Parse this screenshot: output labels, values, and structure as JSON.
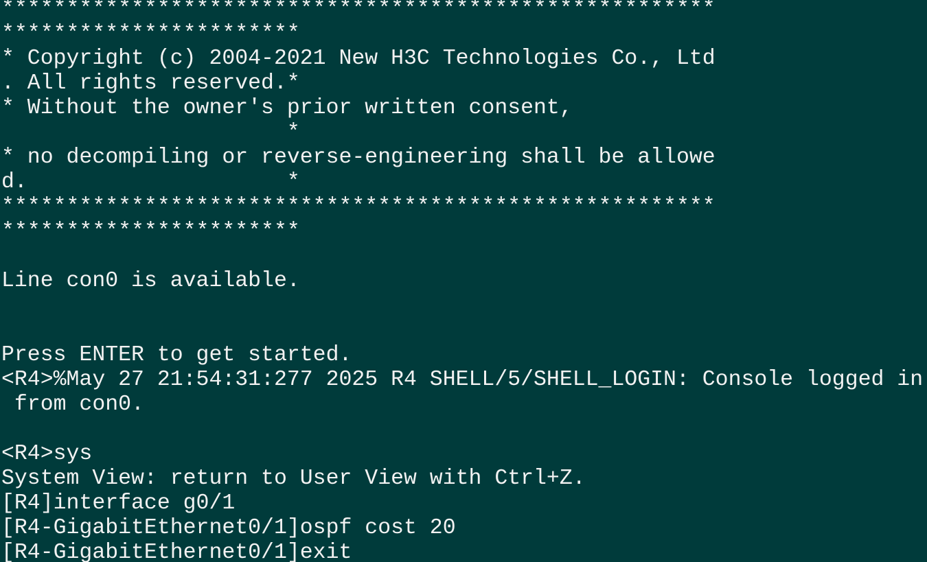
{
  "terminal": {
    "lines": [
      "*******************************************************",
      "***********************",
      "* Copyright (c) 2004-2021 New H3C Technologies Co., Ltd",
      ". All rights reserved.*",
      "* Without the owner's prior written consent,",
      "                      *",
      "* no decompiling or reverse-engineering shall be allowe",
      "d.                    *",
      "*******************************************************",
      "***********************",
      "",
      "Line con0 is available.",
      "",
      "",
      "Press ENTER to get started.",
      "<R4>%May 27 21:54:31:277 2025 R4 SHELL/5/SHELL_LOGIN: Console logged in",
      " from con0.",
      "",
      "<R4>sys",
      "System View: return to User View with Ctrl+Z.",
      "[R4]interface g0/1",
      "[R4-GigabitEthernet0/1]ospf cost 20",
      "[R4-GigabitEthernet0/1]exit"
    ]
  },
  "colors": {
    "background": "#003b3b",
    "foreground": "#f2f2f2"
  }
}
